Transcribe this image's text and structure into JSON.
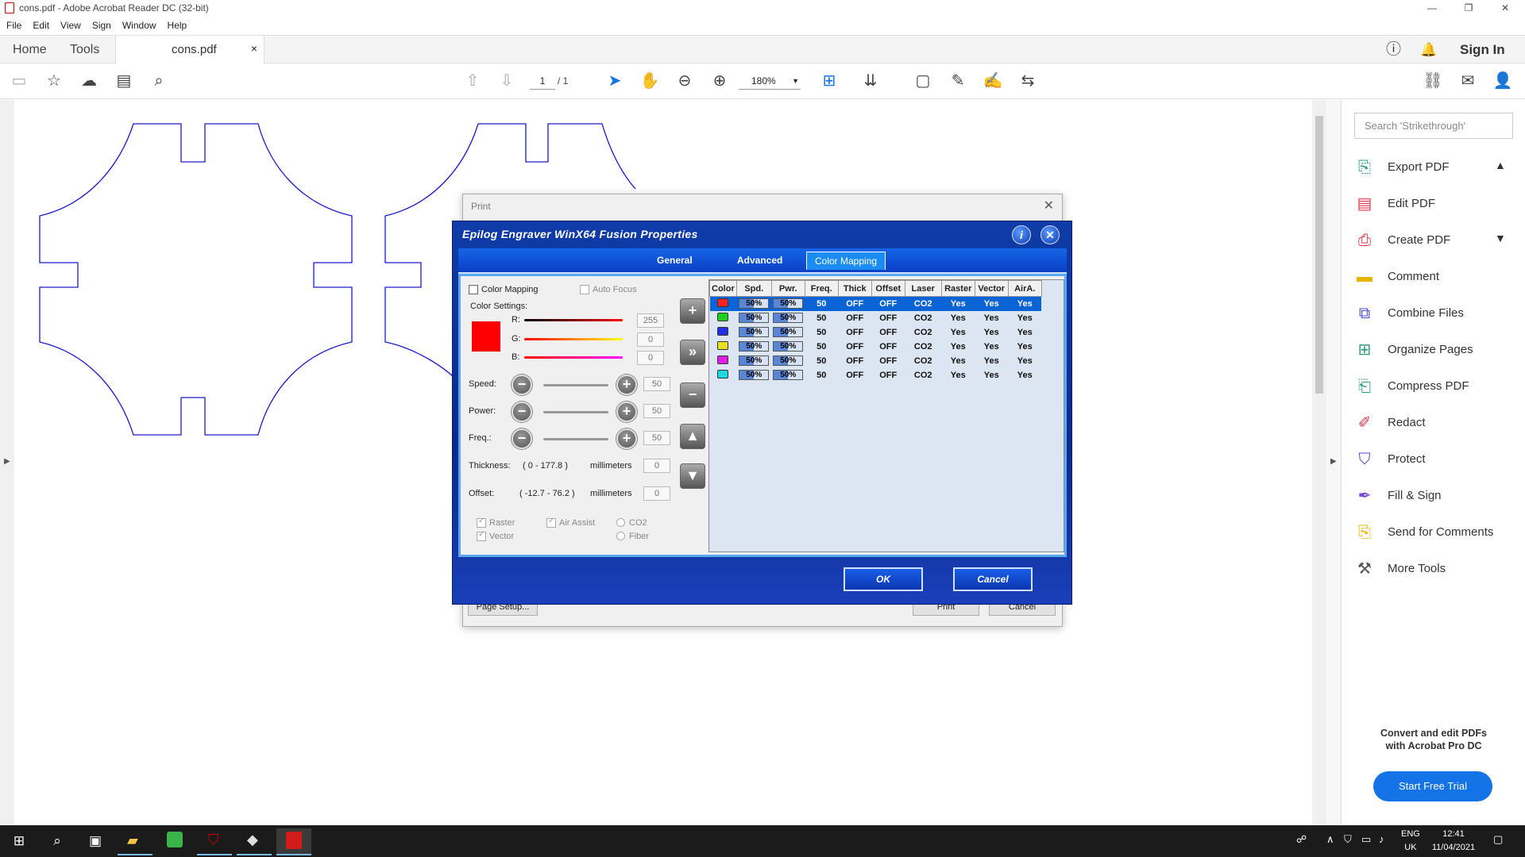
{
  "window": {
    "title": "cons.pdf - Adobe Acrobat Reader DC (32-bit)"
  },
  "menu": [
    "File",
    "Edit",
    "View",
    "Sign",
    "Window",
    "Help"
  ],
  "tabs": {
    "home": "Home",
    "tools": "Tools",
    "document": "cons.pdf",
    "close": "×",
    "sign_in": "Sign In"
  },
  "toolbar": {
    "page_current": "1",
    "page_total": "/ 1",
    "zoom": "180%"
  },
  "right_panel": {
    "search_placeholder": "Search 'Strikethrough'",
    "tools": [
      {
        "label": "Export PDF",
        "icon": "export-pdf-icon",
        "color": "#2d9d78"
      },
      {
        "label": "Edit PDF",
        "icon": "edit-pdf-icon",
        "color": "#e0364e"
      },
      {
        "label": "Create PDF",
        "icon": "create-pdf-icon",
        "color": "#e0364e"
      },
      {
        "label": "Comment",
        "icon": "comment-icon",
        "color": "#e8b400"
      },
      {
        "label": "Combine Files",
        "icon": "combine-files-icon",
        "color": "#4a4ad6"
      },
      {
        "label": "Organize Pages",
        "icon": "organize-pages-icon",
        "color": "#2d9d78"
      },
      {
        "label": "Compress PDF",
        "icon": "compress-pdf-icon",
        "color": "#2d9d78"
      },
      {
        "label": "Redact",
        "icon": "redact-icon",
        "color": "#e0364e"
      },
      {
        "label": "Protect",
        "icon": "protect-icon",
        "color": "#4a4ad6"
      },
      {
        "label": "Fill & Sign",
        "icon": "fill-sign-icon",
        "color": "#7b4ad6"
      },
      {
        "label": "Send for Comments",
        "icon": "send-for-comments-icon",
        "color": "#e8b400"
      },
      {
        "label": "More Tools",
        "icon": "more-tools-icon",
        "color": "#555555"
      }
    ],
    "promo_line1": "Convert and edit PDFs",
    "promo_line2": "with Acrobat Pro DC",
    "trial_button": "Start Free Trial"
  },
  "print_dialog": {
    "title": "Print",
    "page_setup": "Page Setup...",
    "print": "Print",
    "cancel": "Cancel"
  },
  "epilog": {
    "title": "Epilog Engraver WinX64 Fusion Properties",
    "tabs": [
      "General",
      "Advanced",
      "Color Mapping"
    ],
    "color_mapping_label": "Color Mapping",
    "auto_focus_label": "Auto Focus",
    "color_settings_label": "Color Settings:",
    "r_label": "R:",
    "g_label": "G:",
    "b_label": "B:",
    "r_value": "255",
    "g_value": "0",
    "b_value": "0",
    "speed_label": "Speed:",
    "power_label": "Power:",
    "freq_label": "Freq.:",
    "speed_value": "50",
    "power_value": "50",
    "freq_value": "50",
    "thickness_label": "Thickness:",
    "thickness_range": "( 0  -  177.8 )",
    "thickness_unit": "millimeters",
    "thickness_value": "0",
    "offset_label": "Offset:",
    "offset_range": "( -12.7  -  76.2 )",
    "offset_unit": "millimeters",
    "offset_value": "0",
    "raster_label": "Raster",
    "vector_label": "Vector",
    "air_assist_label": "Air Assist",
    "co2_label": "CO2",
    "fiber_label": "Fiber",
    "table_headers": [
      "Color",
      "Spd.",
      "Pwr.",
      "Freq.",
      "Thick",
      "Offset",
      "Laser",
      "Raster",
      "Vector",
      "AirA."
    ],
    "rows": [
      {
        "color": "#ff2020",
        "spd": "50%",
        "pwr": "50%",
        "freq": "50",
        "thick": "OFF",
        "offset": "OFF",
        "laser": "CO2",
        "raster": "Yes",
        "vector": "Yes",
        "aira": "Yes"
      },
      {
        "color": "#20d020",
        "spd": "50%",
        "pwr": "50%",
        "freq": "50",
        "thick": "OFF",
        "offset": "OFF",
        "laser": "CO2",
        "raster": "Yes",
        "vector": "Yes",
        "aira": "Yes"
      },
      {
        "color": "#2030e0",
        "spd": "50%",
        "pwr": "50%",
        "freq": "50",
        "thick": "OFF",
        "offset": "OFF",
        "laser": "CO2",
        "raster": "Yes",
        "vector": "Yes",
        "aira": "Yes"
      },
      {
        "color": "#e8e020",
        "spd": "50%",
        "pwr": "50%",
        "freq": "50",
        "thick": "OFF",
        "offset": "OFF",
        "laser": "CO2",
        "raster": "Yes",
        "vector": "Yes",
        "aira": "Yes"
      },
      {
        "color": "#e020e0",
        "spd": "50%",
        "pwr": "50%",
        "freq": "50",
        "thick": "OFF",
        "offset": "OFF",
        "laser": "CO2",
        "raster": "Yes",
        "vector": "Yes",
        "aira": "Yes"
      },
      {
        "color": "#20d8e0",
        "spd": "50%",
        "pwr": "50%",
        "freq": "50",
        "thick": "OFF",
        "offset": "OFF",
        "laser": "CO2",
        "raster": "Yes",
        "vector": "Yes",
        "aira": "Yes"
      }
    ],
    "ok": "OK",
    "cancel": "Cancel"
  },
  "taskbar": {
    "lang1": "ENG",
    "lang2": "UK",
    "time": "12:41",
    "date": "11/04/2021"
  }
}
